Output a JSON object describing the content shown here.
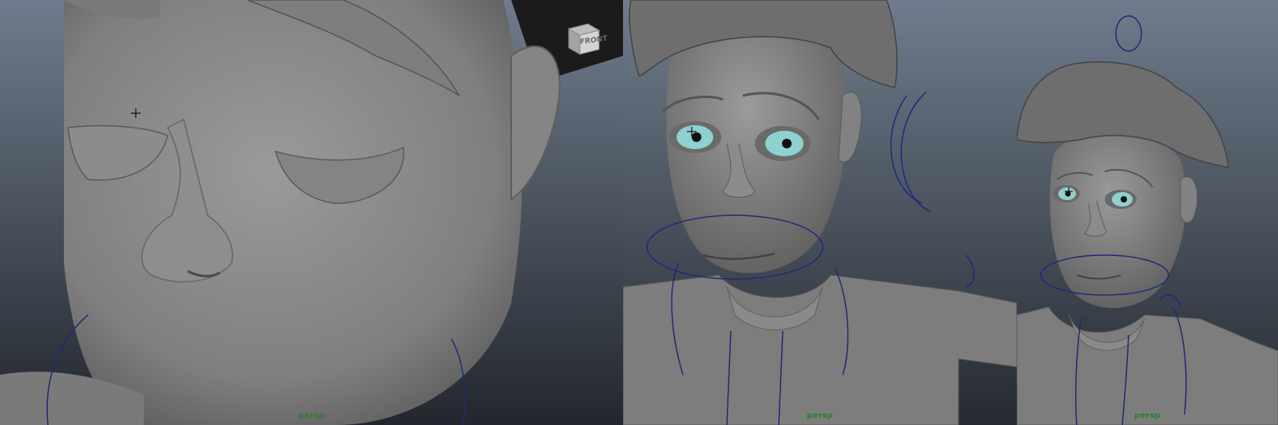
{
  "viewports": [
    {
      "camera": "persp",
      "view_cube": "FRONT"
    },
    {
      "camera": "persp"
    },
    {
      "camera": "persp"
    }
  ],
  "colors": {
    "background_top": "#6f7c8d",
    "background_bottom": "#2a2f36",
    "mesh": "#8a8a8a",
    "control_curve": "#1f2a78",
    "camera_label": "#2f7d2f",
    "iris": "#8fd0d0"
  },
  "icons": [
    "view-cube-icon",
    "crosshair-cursor-icon",
    "control-curve-icon"
  ]
}
